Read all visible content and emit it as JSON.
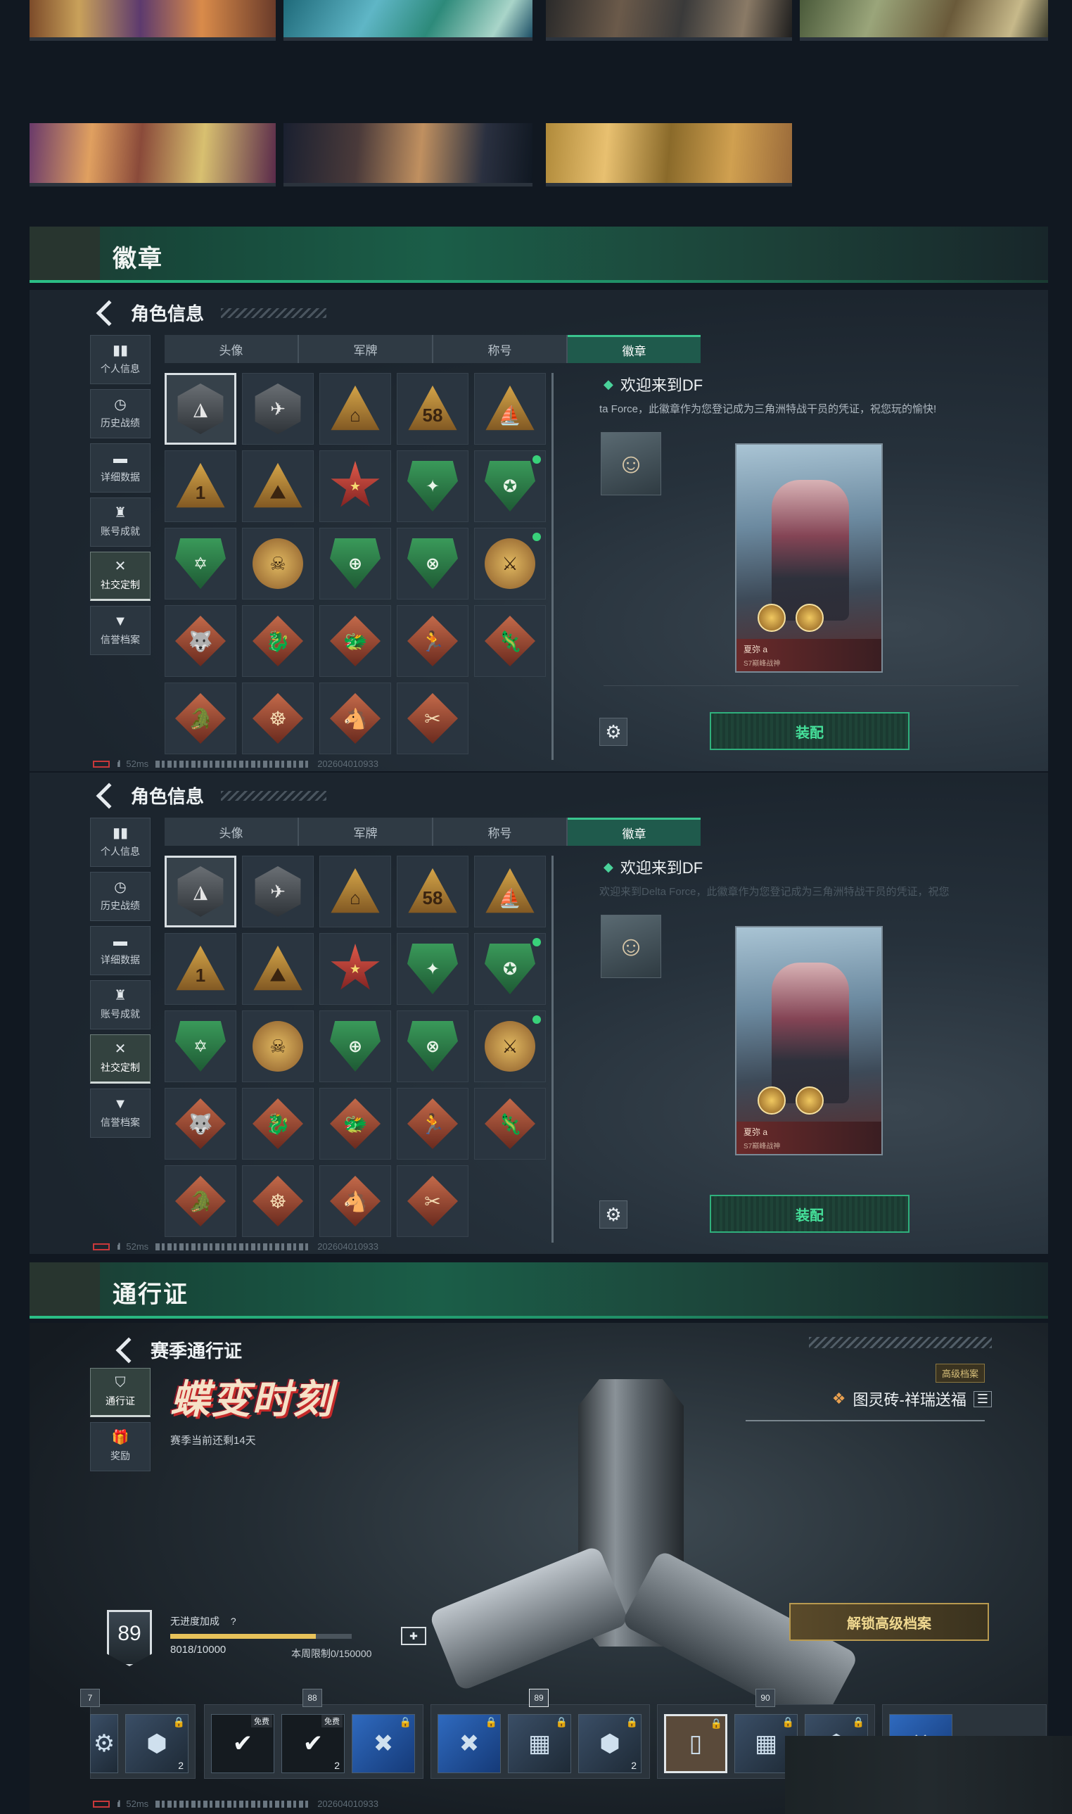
{
  "sections": {
    "badges_title": "徽章",
    "pass_title": "通行证"
  },
  "badge_panel": {
    "title": "角色信息",
    "sidebar": [
      {
        "label": "个人信息",
        "icon": "bar-chart-icon"
      },
      {
        "label": "历史战绩",
        "icon": "history-icon"
      },
      {
        "label": "详细数据",
        "icon": "folder-icon"
      },
      {
        "label": "账号成就",
        "icon": "trophy-icon"
      },
      {
        "label": "社交定制",
        "icon": "tools-icon",
        "active": true
      },
      {
        "label": "信誉档案",
        "icon": "reputation-icon"
      }
    ],
    "tabs": [
      {
        "label": "头像"
      },
      {
        "label": "军牌"
      },
      {
        "label": "称号"
      },
      {
        "label": "徽章",
        "active": true
      }
    ],
    "selected_badge_title": "欢迎来到DF",
    "description_panel1": "ta Force，此徽章作为您登记成为三角洲特战干员的凭证，祝您玩的愉快!",
    "description_panel2": "欢迎来到Delta Force，此徽章作为您登记成为三角洲特战干员的凭证，祝您",
    "card_name": "夏弥 a",
    "card_subtitle": "S7巅峰战神",
    "equip_label": "装配",
    "status": {
      "ping": "52ms",
      "uid": "202604010933"
    }
  },
  "badge_grid": [
    {
      "shape": "hex",
      "glyph": "◮"
    },
    {
      "shape": "hex",
      "glyph": "✈"
    },
    {
      "shape": "tri",
      "glyph": "⌂"
    },
    {
      "shape": "tri",
      "glyph": "58"
    },
    {
      "shape": "tri",
      "glyph": "⛵"
    },
    {
      "shape": "tri",
      "glyph": "1"
    },
    {
      "shape": "tri",
      "glyph": "⛰"
    },
    {
      "shape": "star",
      "glyph": "★"
    },
    {
      "shape": "shield",
      "glyph": "✦"
    },
    {
      "shape": "shield",
      "glyph": "✪",
      "new": true
    },
    {
      "shape": "shield",
      "glyph": "✡"
    },
    {
      "shape": "circle",
      "glyph": "☠"
    },
    {
      "shape": "shield",
      "glyph": "⊕"
    },
    {
      "shape": "shield",
      "glyph": "⊗"
    },
    {
      "shape": "circle",
      "glyph": "⚔",
      "new": true
    },
    {
      "shape": "diamond",
      "glyph": "🐺"
    },
    {
      "shape": "diamond",
      "glyph": "🐉"
    },
    {
      "shape": "diamond",
      "glyph": "🐲"
    },
    {
      "shape": "diamond",
      "glyph": "🏃"
    },
    {
      "shape": "diamond",
      "glyph": "🦎"
    },
    {
      "shape": "diamond",
      "glyph": "🐊"
    },
    {
      "shape": "diamond",
      "glyph": "☸"
    },
    {
      "shape": "diamond",
      "glyph": "🐴"
    },
    {
      "shape": "diamond",
      "glyph": "✂"
    }
  ],
  "pass_panel": {
    "title": "赛季通行证",
    "sidebar": [
      {
        "label": "通行证",
        "icon": "pass-icon",
        "active": true
      },
      {
        "label": "奖励",
        "icon": "gift-icon"
      }
    ],
    "season_name": "蝶变时刻",
    "season_remaining": "赛季当前还剩14天",
    "elite_tag": "高级档案",
    "reward_name": "图灵砖-祥瑞送福",
    "level": "89",
    "boost_label": "无进度加成",
    "boost_help": "?",
    "xp": "8018/10000",
    "xp_progress": 0.8018,
    "weekly_limit": "本周限制0/150000",
    "unlock_label": "解锁高级档案",
    "tiers": [
      "7",
      "88",
      "89",
      "90"
    ],
    "free_tag": "免费",
    "counts": {
      "a": "2",
      "b": "2",
      "c": "2"
    },
    "status": {
      "ping": "52ms",
      "uid": "202604010933"
    }
  }
}
